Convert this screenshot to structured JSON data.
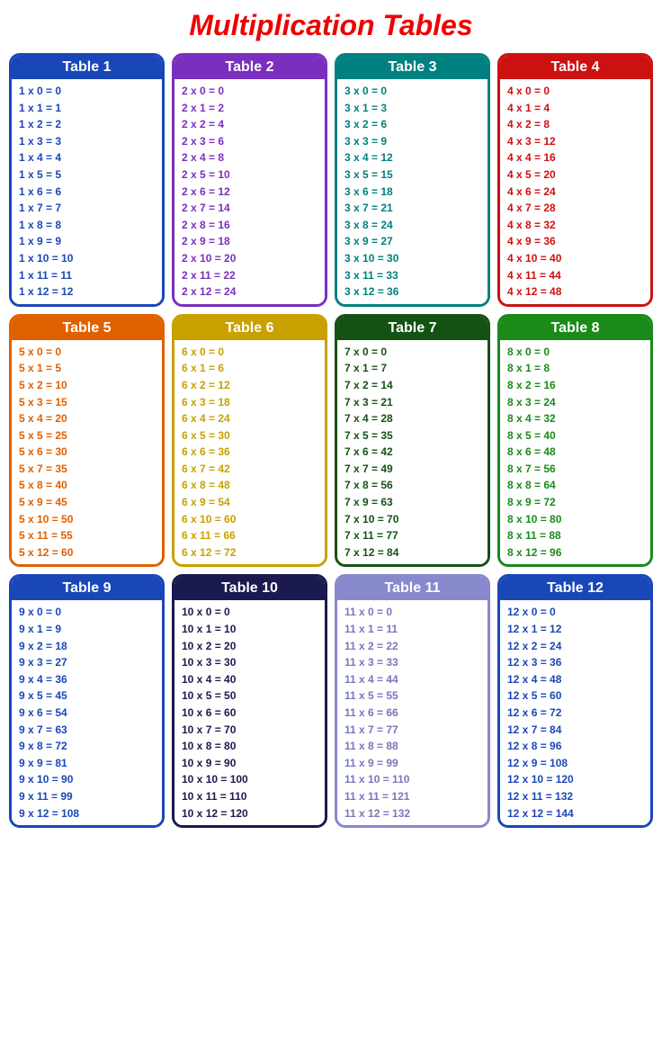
{
  "title": "Multiplication Tables",
  "tables": [
    {
      "id": 1,
      "label": "Table 1",
      "cls": "t1",
      "rows": [
        "1 x 0 = 0",
        "1 x 1 = 1",
        "1 x 2 = 2",
        "1 x 3 = 3",
        "1 x 4 = 4",
        "1 x 5 = 5",
        "1 x 6 = 6",
        "1 x 7 = 7",
        "1 x 8 = 8",
        "1 x 9 = 9",
        "1 x 10 = 10",
        "1 x 11 = 11",
        "1 x 12 = 12"
      ]
    },
    {
      "id": 2,
      "label": "Table 2",
      "cls": "t2",
      "rows": [
        "2 x 0 = 0",
        "2 x 1 = 2",
        "2 x 2 = 4",
        "2 x 3 = 6",
        "2 x 4 = 8",
        "2 x 5 = 10",
        "2 x 6 = 12",
        "2 x 7 = 14",
        "2 x 8 = 16",
        "2 x 9 = 18",
        "2 x 10 = 20",
        "2 x 11 = 22",
        "2 x 12 = 24"
      ]
    },
    {
      "id": 3,
      "label": "Table 3",
      "cls": "t3",
      "rows": [
        "3 x 0 = 0",
        "3 x 1 = 3",
        "3 x 2 = 6",
        "3 x 3 = 9",
        "3 x 4 = 12",
        "3 x 5 = 15",
        "3 x 6 = 18",
        "3 x 7 = 21",
        "3 x 8 = 24",
        "3 x 9 = 27",
        "3 x 10 = 30",
        "3 x 11 = 33",
        "3 x 12 = 36"
      ]
    },
    {
      "id": 4,
      "label": "Table 4",
      "cls": "t4",
      "rows": [
        "4 x 0 = 0",
        "4 x 1 = 4",
        "4 x 2 = 8",
        "4 x 3 = 12",
        "4 x 4 = 16",
        "4 x 5 = 20",
        "4 x 6 = 24",
        "4 x 7 = 28",
        "4 x 8 = 32",
        "4 x 9 = 36",
        "4 x 10 = 40",
        "4 x 11 = 44",
        "4 x 12 = 48"
      ]
    },
    {
      "id": 5,
      "label": "Table 5",
      "cls": "t5",
      "rows": [
        "5 x 0 = 0",
        "5 x 1 = 5",
        "5 x 2 = 10",
        "5 x 3 = 15",
        "5 x 4 = 20",
        "5 x 5 = 25",
        "5 x 6 = 30",
        "5 x 7 = 35",
        "5 x 8 = 40",
        "5 x 9 = 45",
        "5 x 10 = 50",
        "5 x 11 = 55",
        "5 x 12 = 60"
      ]
    },
    {
      "id": 6,
      "label": "Table 6",
      "cls": "t6",
      "rows": [
        "6 x 0 = 0",
        "6 x 1 = 6",
        "6 x 2 = 12",
        "6 x 3 = 18",
        "6 x 4 = 24",
        "6 x 5 = 30",
        "6 x 6 = 36",
        "6 x 7 = 42",
        "6 x 8 = 48",
        "6 x 9 = 54",
        "6 x 10 = 60",
        "6 x 11 = 66",
        "6 x 12 = 72"
      ]
    },
    {
      "id": 7,
      "label": "Table 7",
      "cls": "t7",
      "rows": [
        "7 x 0 = 0",
        "7 x 1 = 7",
        "7 x 2 = 14",
        "7 x 3 = 21",
        "7 x 4 = 28",
        "7 x 5 = 35",
        "7 x 6 = 42",
        "7 x 7 = 49",
        "7 x 8 = 56",
        "7 x 9 = 63",
        "7 x 10 = 70",
        "7 x 11 = 77",
        "7 x 12 = 84"
      ]
    },
    {
      "id": 8,
      "label": "Table 8",
      "cls": "t8",
      "rows": [
        "8 x 0 = 0",
        "8 x 1 = 8",
        "8 x 2 = 16",
        "8 x 3 = 24",
        "8 x 4 = 32",
        "8 x 5 = 40",
        "8 x 6 = 48",
        "8 x 7 = 56",
        "8 x 8 = 64",
        "8 x 9 = 72",
        "8 x 10 = 80",
        "8 x 11 = 88",
        "8 x 12 = 96"
      ]
    },
    {
      "id": 9,
      "label": "Table 9",
      "cls": "t9",
      "rows": [
        "9 x 0 = 0",
        "9 x 1 = 9",
        "9 x 2 = 18",
        "9 x 3 = 27",
        "9 x 4 = 36",
        "9 x 5 = 45",
        "9 x 6 = 54",
        "9 x 7 = 63",
        "9 x 8 = 72",
        "9 x 9 = 81",
        "9 x 10 = 90",
        "9 x 11 = 99",
        "9 x 12 = 108"
      ]
    },
    {
      "id": 10,
      "label": "Table 10",
      "cls": "t10",
      "rows": [
        "10 x 0 = 0",
        "10 x 1 = 10",
        "10 x 2 = 20",
        "10 x 3 = 30",
        "10 x 4 = 40",
        "10 x 5 = 50",
        "10 x 6 = 60",
        "10 x 7 = 70",
        "10 x 8 = 80",
        "10 x 9 = 90",
        "10 x 10 = 100",
        "10 x 11 = 110",
        "10 x 12 = 120"
      ]
    },
    {
      "id": 11,
      "label": "Table 11",
      "cls": "t11",
      "rows": [
        "11 x 0 = 0",
        "11 x 1 = 11",
        "11 x 2 = 22",
        "11 x 3 = 33",
        "11 x 4 = 44",
        "11 x 5 = 55",
        "11 x 6 = 66",
        "11 x 7 = 77",
        "11 x 8 = 88",
        "11 x 9 = 99",
        "11 x 10 = 110",
        "11 x 11 = 121",
        "11 x 12 = 132"
      ]
    },
    {
      "id": 12,
      "label": "Table 12",
      "cls": "t12",
      "rows": [
        "12 x 0 = 0",
        "12 x 1 = 12",
        "12 x 2 = 24",
        "12 x 3 = 36",
        "12 x 4 = 48",
        "12 x 5 = 60",
        "12 x 6 = 72",
        "12 x 7 = 84",
        "12 x 8 = 96",
        "12 x 9 = 108",
        "12 x 10 = 120",
        "12 x 11 = 132",
        "12 x 12 = 144"
      ]
    }
  ]
}
